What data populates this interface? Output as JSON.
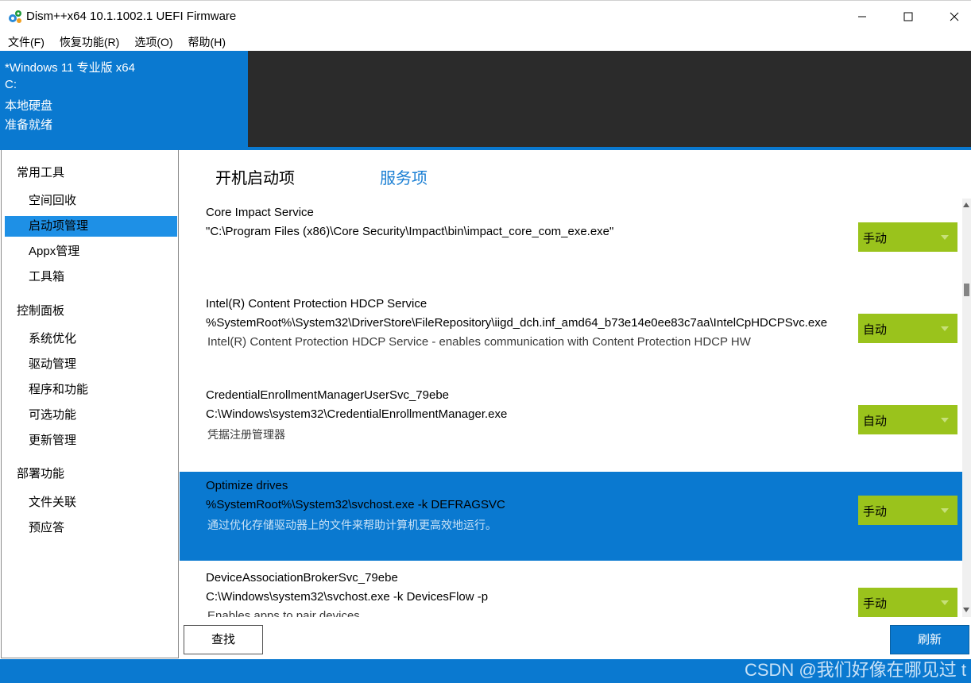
{
  "window": {
    "title": "Dism++x64 10.1.1002.1 UEFI Firmware",
    "icon": "gear-cluster-icon"
  },
  "menu": [
    "文件(F)",
    "恢复功能(R)",
    "选项(O)",
    "帮助(H)"
  ],
  "header": {
    "os": "*Windows 11 专业版 x64",
    "drive": "C:",
    "disk_type": "本地硬盘",
    "status": "准备就绪"
  },
  "sidebar": {
    "categories": [
      {
        "label": "常用工具",
        "items": [
          "空间回收",
          "启动项管理",
          "Appx管理",
          "工具箱"
        ]
      },
      {
        "label": "控制面板",
        "items": [
          "系统优化",
          "驱动管理",
          "程序和功能",
          "可选功能",
          "更新管理"
        ]
      },
      {
        "label": "部署功能",
        "items": [
          "文件关联",
          "预应答"
        ]
      }
    ],
    "active_item": "启动项管理"
  },
  "tabs": {
    "startup": "开机启动项",
    "services": "服务项",
    "active": "services"
  },
  "services": [
    {
      "name": "Core Impact Service",
      "path": "\"C:\\Program Files (x86)\\Core Security\\Impact\\bin\\impact_core_com_exe.exe\"",
      "desc": "",
      "startup": "手动"
    },
    {
      "name": "Intel(R) Content Protection HDCP Service",
      "path": "%SystemRoot%\\System32\\DriverStore\\FileRepository\\iigd_dch.inf_amd64_b73e14e0ee83c7aa\\IntelCpHDCPSvc.exe",
      "desc": "Intel(R) Content Protection HDCP Service - enables communication with Content Protection HDCP HW",
      "startup": "自动"
    },
    {
      "name": "CredentialEnrollmentManagerUserSvc_79ebe",
      "path": "C:\\Windows\\system32\\CredentialEnrollmentManager.exe",
      "desc": "凭据注册管理器",
      "startup": "自动"
    },
    {
      "name": "Optimize drives",
      "path": "%SystemRoot%\\System32\\svchost.exe -k DEFRAGSVC",
      "desc": "通过优化存储驱动器上的文件来帮助计算机更高效地运行。",
      "startup": "手动",
      "selected": true
    },
    {
      "name": "DeviceAssociationBrokerSvc_79ebe",
      "path": "C:\\Windows\\system32\\svchost.exe -k DevicesFlow -p",
      "desc": "Enables apps to pair devices",
      "startup": "手动"
    }
  ],
  "buttons": {
    "find": "查找",
    "refresh": "刷新"
  },
  "watermark": "CSDN @我们好像在哪见过 t",
  "colors": {
    "accent": "#0a79d0",
    "header_dark": "#2b2b2b",
    "dropdown": "#9ac31c",
    "sidebar_active": "#1e90e6",
    "tab_active": "#1a7fd4"
  }
}
